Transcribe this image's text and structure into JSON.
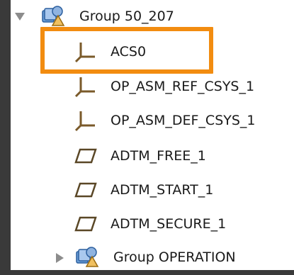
{
  "tree": {
    "group_top": {
      "label": "Group 50_207",
      "expanded": true,
      "icon": "group-assembly-icon"
    },
    "items": [
      {
        "label": "ACS0",
        "icon": "csys-icon",
        "highlighted": true
      },
      {
        "label": "OP_ASM_REF_CSYS_1",
        "icon": "csys-icon"
      },
      {
        "label": "OP_ASM_DEF_CSYS_1",
        "icon": "csys-icon"
      },
      {
        "label": "ADTM_FREE_1",
        "icon": "datum-plane-icon"
      },
      {
        "label": "ADTM_START_1",
        "icon": "datum-plane-icon"
      },
      {
        "label": "ADTM_SECURE_1",
        "icon": "datum-plane-icon"
      }
    ],
    "group_bottom": {
      "label": "Group OPERATION",
      "expanded": false,
      "icon": "group-assembly-icon"
    }
  },
  "colors": {
    "highlight": "#f28c10",
    "csys_icon": "#7a5a2a",
    "datum_icon": "#5a4726",
    "panel_bg": "#ffffff",
    "frame_bg": "#3a3a3a"
  }
}
